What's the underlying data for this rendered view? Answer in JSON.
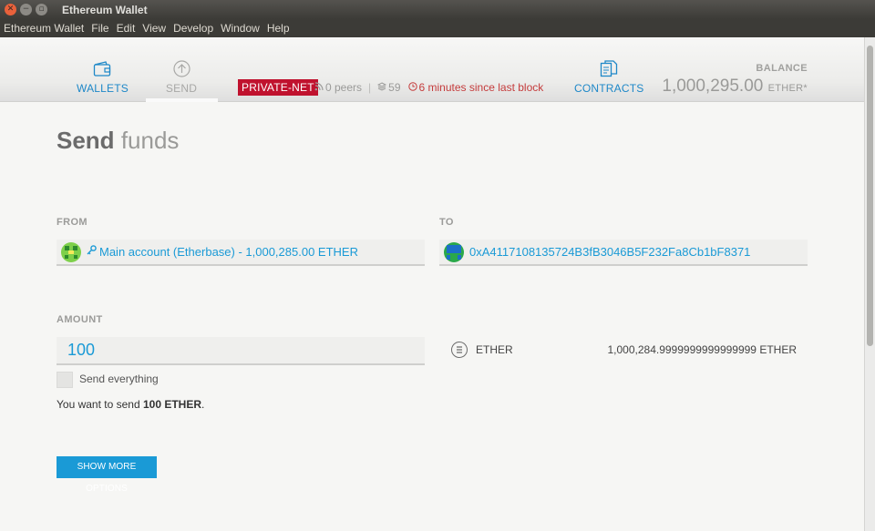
{
  "window": {
    "title": "Ethereum Wallet"
  },
  "menu": {
    "items": [
      "Ethereum Wallet",
      "File",
      "Edit",
      "View",
      "Develop",
      "Window",
      "Help"
    ]
  },
  "nav": {
    "wallets": "WALLETS",
    "send": "SEND",
    "contracts": "CONTRACTS"
  },
  "network": {
    "badge": "PRIVATE-NET",
    "peers": "0 peers",
    "separator": "|",
    "blocks": "59",
    "last_block": "6 minutes since last block"
  },
  "balance": {
    "label": "BALANCE",
    "value": "1,000,295.00",
    "unit": "ETHER*"
  },
  "page": {
    "title_strong": "Send",
    "title_light": "funds"
  },
  "from": {
    "label": "FROM",
    "value": "Main account (Etherbase) - 1,000,285.00 ETHER"
  },
  "to": {
    "label": "TO",
    "value": "0xA4117108135724B3fB3046B5F232Fa8Cb1bF8371"
  },
  "amount": {
    "label": "AMOUNT",
    "value": "100",
    "send_everything": "Send everything",
    "summary_prefix": "You want to send ",
    "summary_amount": "100 ETHER",
    "summary_suffix": "."
  },
  "currency": {
    "label": "ETHER",
    "available": "1,000,284.9999999999999999 ETHER"
  },
  "buttons": {
    "more_options": "SHOW MORE OPTIONS"
  },
  "colors": {
    "accent": "#1a9ad6",
    "warning": "#c0122e",
    "title_bar": "#3c3b37"
  }
}
